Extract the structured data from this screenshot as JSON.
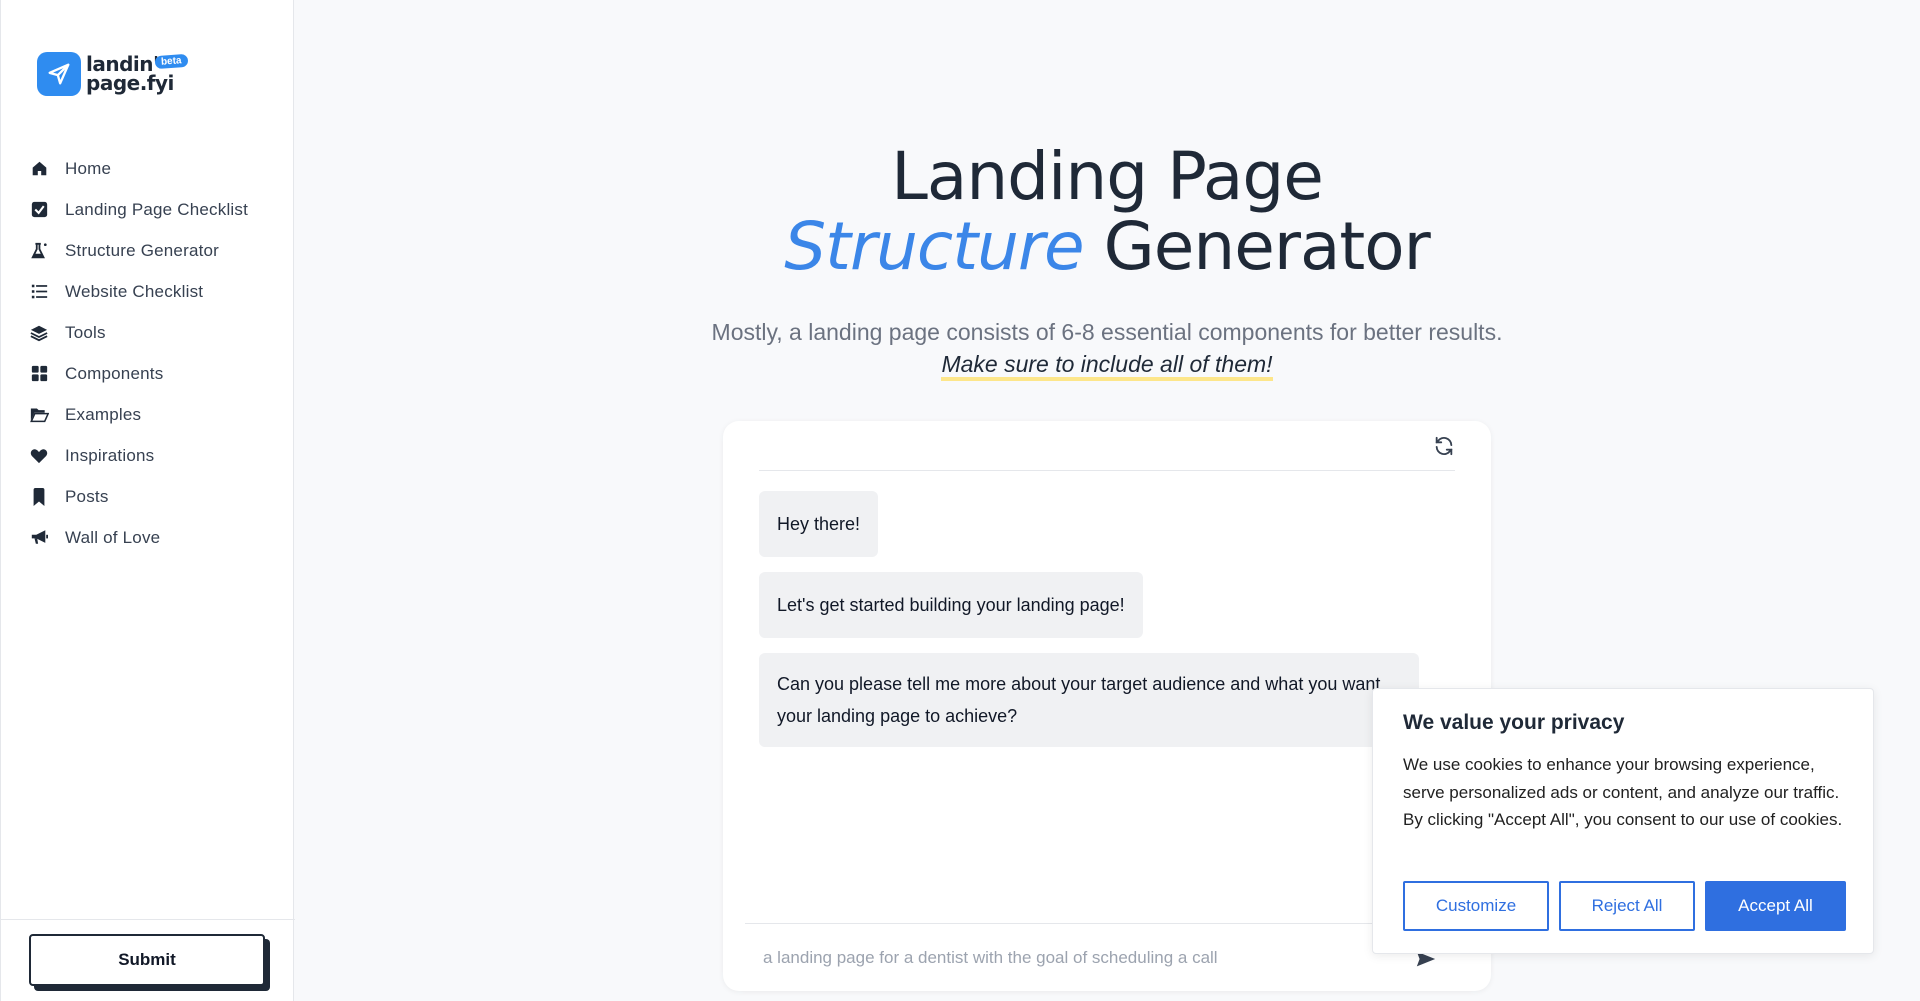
{
  "logo": {
    "line1": "landin'",
    "line2": "page.fyi",
    "badge": "beta"
  },
  "sidebar": {
    "items": [
      {
        "label": "Home",
        "icon": "home-icon"
      },
      {
        "label": "Landing Page Checklist",
        "icon": "check-square-icon"
      },
      {
        "label": "Structure Generator",
        "icon": "flask-icon"
      },
      {
        "label": "Website Checklist",
        "icon": "list-icon"
      },
      {
        "label": "Tools",
        "icon": "layers-icon"
      },
      {
        "label": "Components",
        "icon": "grid-icon"
      },
      {
        "label": "Examples",
        "icon": "folder-open-icon"
      },
      {
        "label": "Inspirations",
        "icon": "heart-icon"
      },
      {
        "label": "Posts",
        "icon": "bookmark-icon"
      },
      {
        "label": "Wall of Love",
        "icon": "megaphone-icon"
      }
    ],
    "submit_label": "Submit"
  },
  "hero": {
    "title_line1": "Landing Page",
    "title_accent": "Structure",
    "title_rest": " Generator",
    "subtitle": "Mostly, a landing page consists of 6-8 essential components for better results.",
    "subtitle_emphasis": "Make sure to include all of them!"
  },
  "chat": {
    "messages": [
      "Hey there!",
      "Let's get started building your landing page!",
      "Can you please tell me more about your target audience and what you want your landing page to achieve?"
    ],
    "input_placeholder": "a landing page for a dentist with the goal of scheduling a call"
  },
  "cookie": {
    "title": "We value your privacy",
    "text": "We use cookies to enhance your browsing experience, serve personalized ads or content, and analyze our traffic. By clicking \"Accept All\", you consent to our use of cookies.",
    "customize": "Customize",
    "reject": "Reject All",
    "accept": "Accept All"
  },
  "colors": {
    "accent": "#3b86e8",
    "brand": "#2f8cf0",
    "cookie_blue": "#2f6fe0",
    "highlight": "#fde68a"
  }
}
